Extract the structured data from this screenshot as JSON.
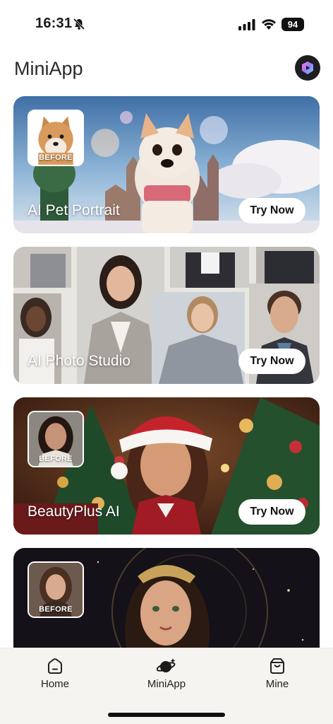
{
  "status_bar": {
    "time": "16:31",
    "battery": "94"
  },
  "header": {
    "title": "MiniApp"
  },
  "cards": [
    {
      "title": "AI Pet Portrait",
      "button": "Try Now",
      "before": "BEFORE"
    },
    {
      "title": "AI Photo Studio",
      "button": "Try Now"
    },
    {
      "title": "BeautyPlus AI",
      "button": "Try Now",
      "before": "BEFORE"
    },
    {
      "before": "BEFORE"
    }
  ],
  "tabbar": {
    "home": "Home",
    "miniapp": "MiniApp",
    "mine": "Mine"
  }
}
